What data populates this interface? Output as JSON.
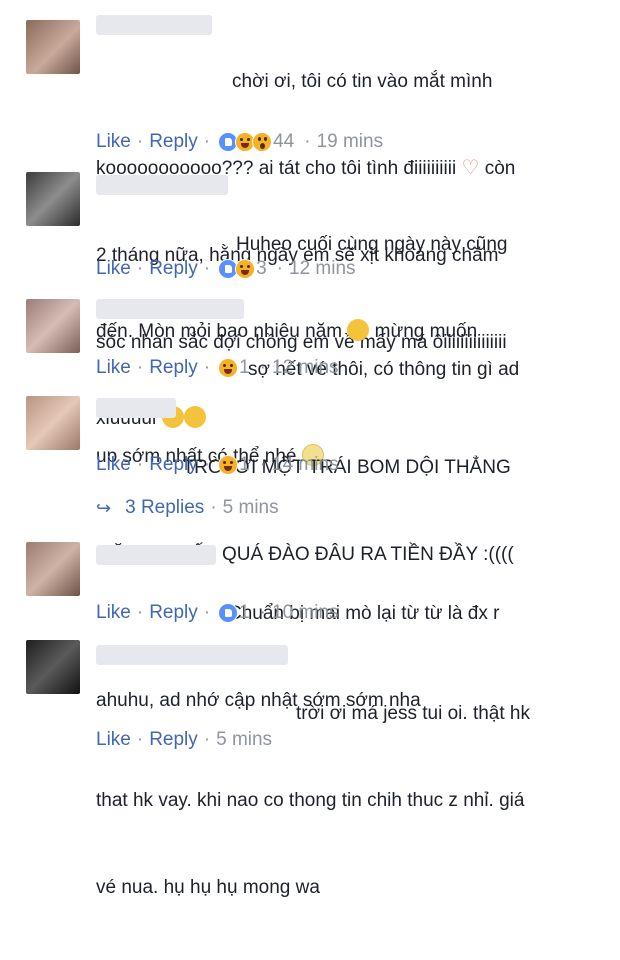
{
  "actions": {
    "like": "Like",
    "reply": "Reply",
    "sep": "·"
  },
  "comments": [
    {
      "text": "chời ơi, tôi có tin vào mắt mình kooooooooooo??? ai tát cho tôi tình điiiiiiiiii ♡ còn 2 tháng nữa, hằng ngày em sẽ xịt khoáng chăm sóc nhan sắc đợi chồng em về mấy má ôiiiiiiiiiiiiiii",
      "line1": "chời ơi, tôi có tin vào mắt mình",
      "line2a": "kooooooooooo??? ai tát cho tôi tình điiiiiiiiii",
      "line2b": "còn",
      "line3": "2 tháng nữa, hằng ngày em sẽ xịt khoáng chăm",
      "line4": "sóc nhan sắc đợi chồng em về mấy má ôiiiiiiiiiiiiiii",
      "reactions": [
        "like",
        "haha",
        "wow"
      ],
      "count": "44",
      "time": "19 mins"
    },
    {
      "line1": "Huheo cuối cùng ngày này cũng",
      "line2a": "đến. Mòn mỏi bao nhiêu năm",
      "line2b": "mừng muốn",
      "line3": "xỉuuuui",
      "reactions": [
        "like",
        "haha"
      ],
      "count": "3",
      "time": "12 mins"
    },
    {
      "line1": "sợ hết vé thôi, có thông tin gì ad",
      "line2": "up sớm nhất có thể nhé",
      "reactions": [
        "haha"
      ],
      "count": "1",
      "time": "12 mins"
    },
    {
      "line1": "' TRỜI ƠI MỘT TRÁI BOM DỘI THẲNG",
      "line2": "MẶT :(((( GẤP QUÁ ĐÀO ĐÂU RA TIỀN ĐẦY :((((",
      "reactions": [
        "haha"
      ],
      "count": "1",
      "time": "14 mins"
    },
    {
      "line1": "Chuẩn bị mai mò lại từ từ là đx r",
      "line2": "ahuhu, ad nhớ cập nhật sớm sớm nha",
      "reactions": [
        "like"
      ],
      "count": "1",
      "time": "10 mins"
    },
    {
      "line1": "trời ơi má jess tui oi. thật hk",
      "line2": "that hk vay. khi nao co thong tin chih thuc z nhỉ. giá",
      "line3": "vé nua. hụ hụ hụ mong wa",
      "time": "5 mins"
    }
  ],
  "replies": {
    "label": "3 Replies",
    "time": "5 mins"
  },
  "colors": {
    "link": "#4267b2",
    "meta": "#90949c",
    "text": "#1d2129"
  }
}
